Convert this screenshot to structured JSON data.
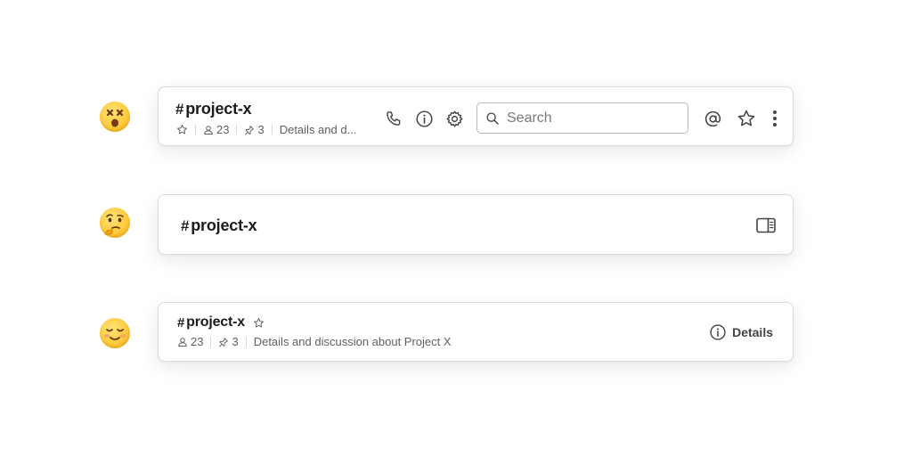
{
  "variants": [
    {
      "emoji": "dizzy-face-emoji",
      "channel": {
        "hash": "#",
        "name": "project-x"
      },
      "members": "23",
      "pins": "3",
      "description": "Details and d...",
      "search": {
        "placeholder": "Search",
        "value": ""
      },
      "icons": [
        "star-outline-icon",
        "person-icon",
        "pin-icon",
        "phone-icon",
        "info-icon",
        "gear-icon",
        "search-icon",
        "at-sign-icon",
        "star-icon",
        "kebab-menu-icon"
      ]
    },
    {
      "emoji": "thinking-face-emoji",
      "channel": {
        "hash": "#",
        "name": "project-x"
      },
      "icons": [
        "sidebar-toggle-icon"
      ]
    },
    {
      "emoji": "smiling-face-emoji",
      "channel": {
        "hash": "#",
        "name": "project-x"
      },
      "members": "23",
      "pins": "3",
      "description": "Details and discussion about Project X",
      "details_label": "Details",
      "icons": [
        "star-outline-icon",
        "person-icon",
        "pin-icon",
        "info-icon"
      ]
    }
  ],
  "colors": {
    "text": "#1d1c1d",
    "muted": "#616061",
    "border": "#dcdcdc",
    "emoji": "#ffcc3d"
  }
}
